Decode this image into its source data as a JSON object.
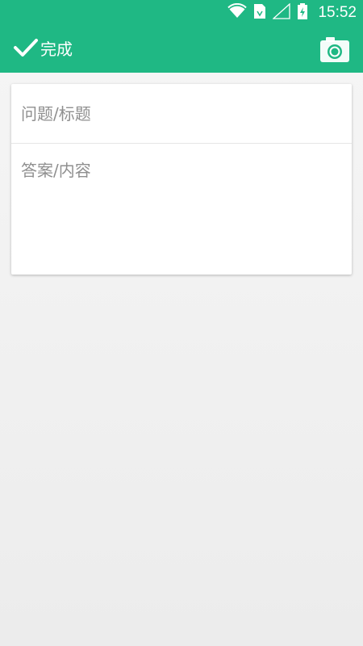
{
  "status_bar": {
    "time": "15:52",
    "icons": [
      "wifi-icon",
      "sim-card-icon",
      "cell-signal-icon",
      "battery-charging-icon"
    ]
  },
  "toolbar": {
    "done_label": "完成",
    "done_icon": "checkmark-icon",
    "camera_icon": "camera-icon"
  },
  "form": {
    "title_placeholder": "问题/标题",
    "title_value": "",
    "content_placeholder": "答案/内容",
    "content_value": ""
  },
  "colors": {
    "accent": "#1fb884",
    "background": "#f2f2f2",
    "card": "#ffffff"
  }
}
